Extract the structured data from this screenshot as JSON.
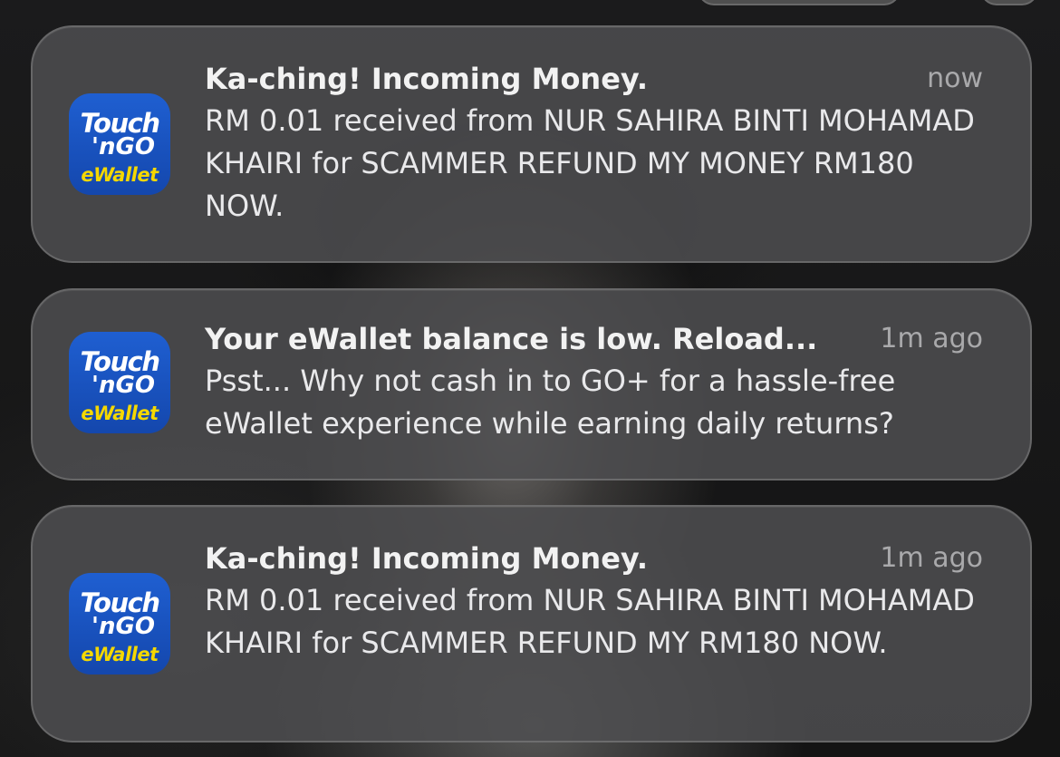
{
  "notifications": [
    {
      "app": {
        "icon_name": "touch-n-go-ewallet-icon",
        "line1": "Touch",
        "line2": "'nGO",
        "line3": "eWallet"
      },
      "title": "Ka-ching! Incoming Money.",
      "time": "now",
      "body": "RM 0.01 received from NUR SAHIRA BINTI MOHAMAD KHAIRI for SCAMMER REFUND MY MONEY RM180 NOW."
    },
    {
      "app": {
        "icon_name": "touch-n-go-ewallet-icon",
        "line1": "Touch",
        "line2": "'nGO",
        "line3": "eWallet"
      },
      "title": "Your eWallet balance is low. Reload...",
      "time": "1m ago",
      "body": "Psst... Why not cash in to GO+ for a hassle-free eWallet experience while earning daily returns?"
    },
    {
      "app": {
        "icon_name": "touch-n-go-ewallet-icon",
        "line1": "Touch",
        "line2": "'nGO",
        "line3": "eWallet"
      },
      "title": "Ka-ching! Incoming Money.",
      "time": "1m ago",
      "body": "RM 0.01 received from NUR SAHIRA BINTI MOHAMAD KHAIRI for SCAMMER REFUND MY RM180 NOW."
    }
  ],
  "colors": {
    "icon_blue": "#1a55c4",
    "icon_yellow": "#f5d800",
    "card_bg": "#4e4e50",
    "title_text": "#f2f2f2",
    "time_text": "#a9a9ab"
  }
}
